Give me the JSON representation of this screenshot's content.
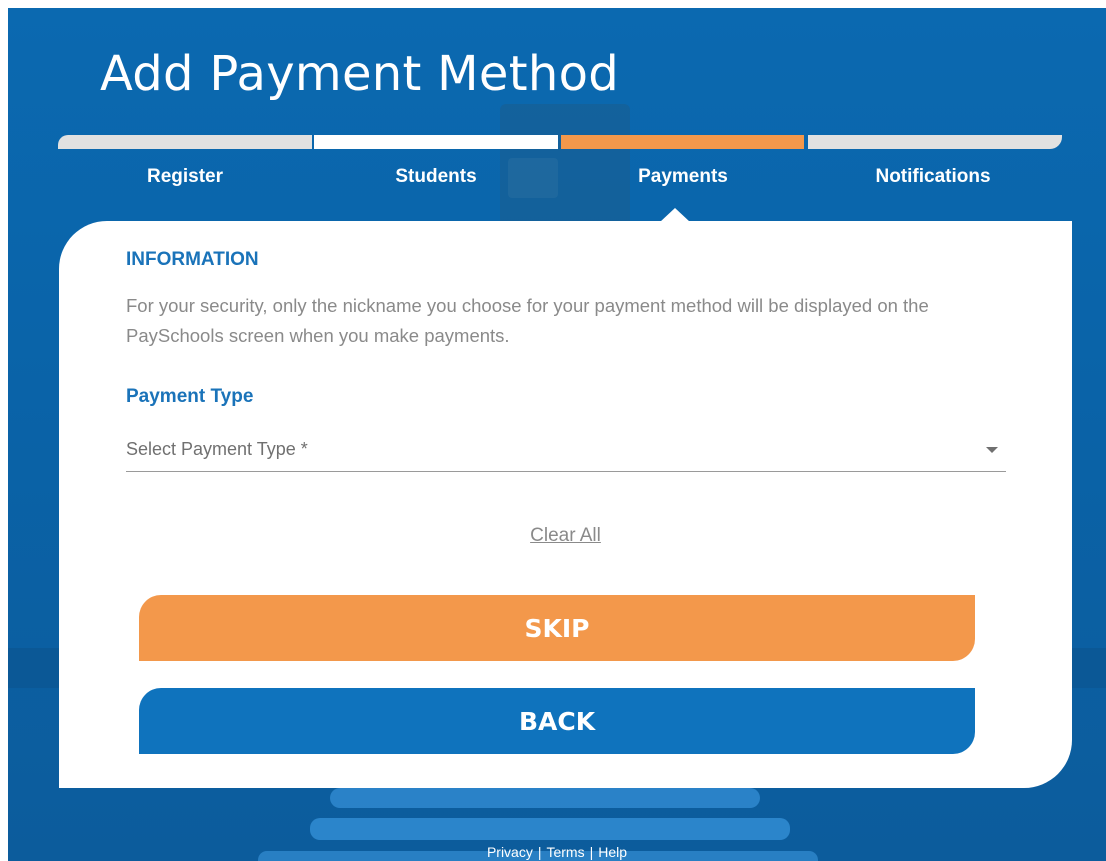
{
  "page": {
    "title": "Add Payment Method"
  },
  "steps": [
    {
      "label": "Register",
      "state": "complete"
    },
    {
      "label": "Students",
      "state": "complete"
    },
    {
      "label": "Payments",
      "state": "current"
    },
    {
      "label": "Notifications",
      "state": "pending"
    }
  ],
  "info": {
    "heading": "INFORMATION",
    "text": "For your security, only the nickname you choose for your payment method will be displayed on the PaySchools screen when you make payments."
  },
  "payment_type": {
    "label": "Payment Type",
    "placeholder": "Select Payment Type *"
  },
  "actions": {
    "clear_all": "Clear All",
    "skip": "SKIP",
    "back": "BACK"
  },
  "footer": {
    "privacy": "Privacy",
    "terms": "Terms",
    "help": "Help",
    "separator": "|"
  },
  "colors": {
    "brand_blue": "#1a73b9",
    "accent_orange": "#f3984b",
    "button_blue": "#0f73bd"
  }
}
